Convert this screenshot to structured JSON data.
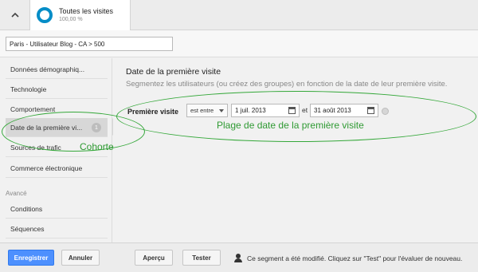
{
  "topbar": {
    "segment_title": "Toutes les visites",
    "segment_percent": "100,00 %",
    "collapse_icon": "chevron-up-icon"
  },
  "segment_name": {
    "value": "Paris - Utilisateur Blog - CA > 500"
  },
  "sidebar": {
    "items": [
      {
        "label": "Données démographiq..."
      },
      {
        "label": "Technologie"
      },
      {
        "label": "Comportement"
      },
      {
        "label": "Date de la première vi...",
        "badge": "1",
        "active": true
      },
      {
        "label": "Sources de trafic"
      },
      {
        "label": "Commerce électronique"
      }
    ],
    "section_header": "Avancé",
    "advanced_items": [
      {
        "label": "Conditions"
      },
      {
        "label": "Séquences"
      }
    ]
  },
  "main": {
    "title": "Date de la première visite",
    "description": "Segmentez les utilisateurs (ou créez des groupes) en fonction de la date de leur première visite.",
    "row_label": "Première visite",
    "operator": "est entre",
    "start_date": "1 juil. 2013",
    "conjunction": "et",
    "end_date": "31 août 2013"
  },
  "annotations": {
    "range_label": "Plage de date de la première visite",
    "cohort_label": "Cohorte",
    "color": "#35a83a"
  },
  "footer": {
    "save_label": "Enregistrer",
    "cancel_label": "Annuler",
    "preview_label": "Aperçu",
    "test_label": "Tester",
    "status": "Ce segment a été modifié. Cliquez sur \"Test\" pour l'évaluer de nouveau.",
    "primary_color": "#4d90fe"
  }
}
